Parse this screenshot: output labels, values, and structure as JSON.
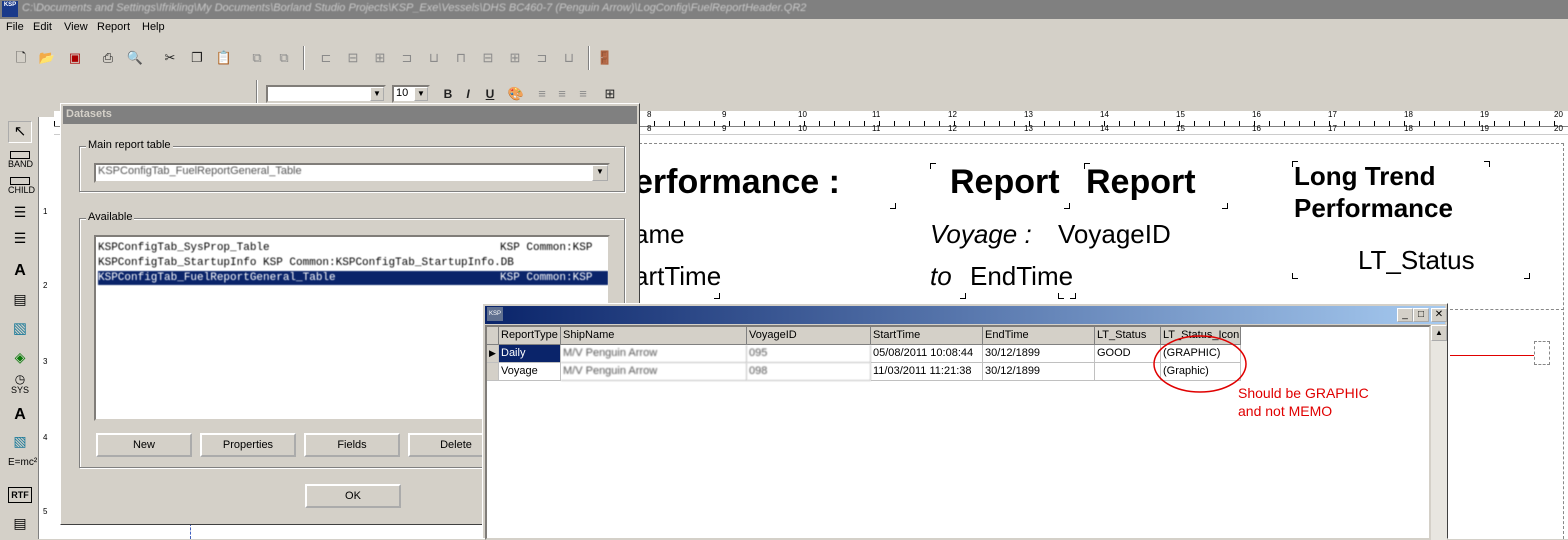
{
  "window": {
    "title": "C:\\Documents and Settings\\Ifrikling\\My Documents\\Borland Studio Projects\\KSP_Exe\\Vessels\\DHS BC460-7 (Penguin Arrow)\\LogConfig\\FuelReportHeader.QR2",
    "icon_text": "KSP"
  },
  "menu": [
    "File",
    "Edit",
    "View",
    "Report",
    "Help"
  ],
  "font_toolbar": {
    "font_name": "",
    "font_size": "10",
    "bold": "B",
    "italic": "I",
    "underline": "U"
  },
  "palette": {
    "band": "BAND",
    "child": "CHILD",
    "label_a": "A",
    "sys": "SYS",
    "expr": "E=mc²",
    "rtf": "RTF"
  },
  "vruler_numbers": [
    "1",
    "2",
    "3",
    "4",
    "5"
  ],
  "hruler_top_numbers": [
    "8",
    "9",
    "10",
    "11",
    "12",
    "13",
    "14",
    "15",
    "16",
    "17",
    "18",
    "19",
    "20"
  ],
  "hruler_bottom_numbers": [
    "8",
    "9",
    "10",
    "11",
    "12",
    "13",
    "14",
    "15",
    "16",
    "17",
    "18",
    "19",
    "20"
  ],
  "report": {
    "performance": "erformance :",
    "report1": "Report",
    "report2": "Report",
    "long_trend_1": "Long Trend",
    "long_trend_2": "Performance",
    "name_field": "ame",
    "voyage_label": "Voyage :",
    "voyage_id": "VoyageID",
    "lt_status": "LT_Status",
    "start_field": "artTime",
    "to_label": "to",
    "end_field": "EndTime"
  },
  "datasets_dialog": {
    "title": "Datasets",
    "main_label": "Main report table",
    "main_value": "KSPConfigTab_FuelReportGeneral_Table",
    "available_label": "Available",
    "available_items": [
      {
        "name": "KSPConfigTab_SysProp_Table",
        "group": "KSP Common:KSP"
      },
      {
        "name": "KSPConfigTab_StartupInfo KSP Common:KSPConfigTab_StartupInfo.DB",
        "group": ""
      },
      {
        "name": "KSPConfigTab_FuelReportGeneral_Table",
        "group": "KSP Common:KSP"
      }
    ],
    "buttons": {
      "new": "New",
      "properties": "Properties",
      "fields": "Fields",
      "delete": "Delete",
      "ok": "OK"
    }
  },
  "grid_window": {
    "title": "KSP",
    "caption_min": "_",
    "caption_max": "□",
    "caption_close": "✕",
    "columns": [
      "ReportType",
      "ShipName",
      "VoyageID",
      "StartTime",
      "EndTime",
      "LT_Status",
      "LT_Status_Icon"
    ],
    "rows": [
      [
        "Daily",
        "M/V Penguin Arrow",
        "095",
        "05/08/2011 10:08:44",
        "30/12/1899",
        "GOOD",
        "(GRAPHIC)"
      ],
      [
        "Voyage",
        "M/V Penguin Arrow",
        "098",
        "11/03/2011 11:21:38",
        "30/12/1899",
        "",
        "(Graphic)"
      ]
    ]
  },
  "annotation": {
    "line1": "Should be GRAPHIC",
    "line2": "and not MEMO",
    "color": "#e00000"
  }
}
